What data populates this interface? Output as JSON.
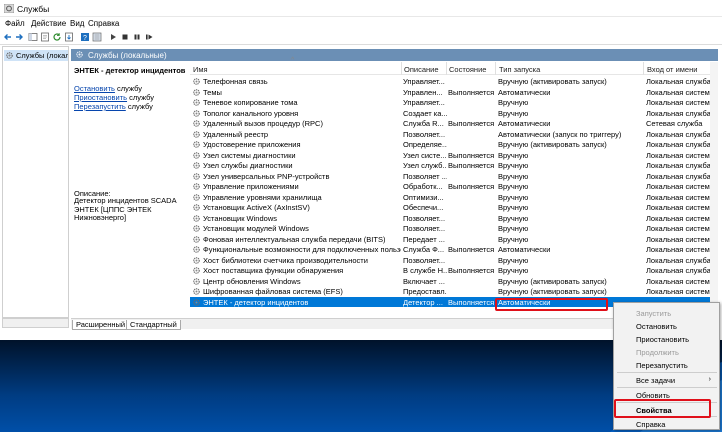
{
  "window": {
    "title": "Службы"
  },
  "menu": [
    "Файл",
    "Действие",
    "Вид",
    "Справка"
  ],
  "tree": {
    "item": "Службы (локальные)"
  },
  "header": {
    "title": "Службы (локальные)"
  },
  "description_panel": {
    "service_name": "ЭНТЕК - детектор инцидентов",
    "actions": [
      {
        "link": "Остановить",
        "suffix": " службу"
      },
      {
        "link": "Приостановить",
        "suffix": " службу"
      },
      {
        "link": "Перезапустить",
        "suffix": " службу"
      }
    ],
    "description_label": "Описание:",
    "description_text": "Детектор инцидентов SCADA ЭНТЕК [ЦППС ЭНТЕК Нижновэнерго]"
  },
  "columns": {
    "name": "Имя",
    "description": "Описание",
    "state": "Состояние",
    "startup_type": "Тип запуска",
    "logon": "Вход от имени"
  },
  "rows": [
    {
      "name": "Телефонная связь",
      "desc": "Управляет...",
      "state": "",
      "type": "Вручную (активировать запуск)",
      "logon": "Локальная служба"
    },
    {
      "name": "Темы",
      "desc": "Управлен...",
      "state": "Выполняется",
      "type": "Автоматически",
      "logon": "Локальная система"
    },
    {
      "name": "Теневое копирование тома",
      "desc": "Управляет...",
      "state": "",
      "type": "Вручную",
      "logon": "Локальная система"
    },
    {
      "name": "Тополог канального уровня",
      "desc": "Создает ка...",
      "state": "",
      "type": "Вручную",
      "logon": "Локальная служба"
    },
    {
      "name": "Удаленный вызов процедур (RPC)",
      "desc": "Служба R...",
      "state": "Выполняется",
      "type": "Автоматически",
      "logon": "Сетевая служба"
    },
    {
      "name": "Удаленный реестр",
      "desc": "Позволяет...",
      "state": "",
      "type": "Автоматически (запуск по триггеру)",
      "logon": "Локальная служба"
    },
    {
      "name": "Удостоверение приложения",
      "desc": "Определяе...",
      "state": "",
      "type": "Вручную (активировать запуск)",
      "logon": "Локальная служба"
    },
    {
      "name": "Узел системы диагностики",
      "desc": "Узел систе...",
      "state": "Выполняется",
      "type": "Вручную",
      "logon": "Локальная система"
    },
    {
      "name": "Узел службы диагностики",
      "desc": "Узел служб...",
      "state": "Выполняется",
      "type": "Вручную",
      "logon": "Локальная служба"
    },
    {
      "name": "Узел универсальных PNP-устройств",
      "desc": "Позволяет ...",
      "state": "",
      "type": "Вручную",
      "logon": "Локальная служба"
    },
    {
      "name": "Управление приложениями",
      "desc": "Обработк...",
      "state": "Выполняется",
      "type": "Вручную",
      "logon": "Локальная система"
    },
    {
      "name": "Управление уровнями хранилища",
      "desc": "Оптимизи...",
      "state": "",
      "type": "Вручную",
      "logon": "Локальная система"
    },
    {
      "name": "Установщик ActiveX (AxInstSV)",
      "desc": "Обеспечи...",
      "state": "",
      "type": "Вручную",
      "logon": "Локальная система"
    },
    {
      "name": "Установщик Windows",
      "desc": "Позволяет...",
      "state": "",
      "type": "Вручную",
      "logon": "Локальная система"
    },
    {
      "name": "Установщик модулей Windows",
      "desc": "Позволяет...",
      "state": "",
      "type": "Вручную",
      "logon": "Локальная система"
    },
    {
      "name": "Фоновая интеллектуальная служба передачи (BITS)",
      "desc": "Передает ...",
      "state": "",
      "type": "Вручную",
      "logon": "Локальная система"
    },
    {
      "name": "Функциональные возможности для подключенных пользова...",
      "desc": "Служба Ф...",
      "state": "Выполняется",
      "type": "Автоматически",
      "logon": "Локальная система"
    },
    {
      "name": "Хост библиотеки счетчика производительности",
      "desc": "Позволяет...",
      "state": "",
      "type": "Вручную",
      "logon": "Локальная служба"
    },
    {
      "name": "Хост поставщика функции обнаружения",
      "desc": "В службе Н...",
      "state": "Выполняется",
      "type": "Вручную",
      "logon": "Локальная служба"
    },
    {
      "name": "Центр обновления Windows",
      "desc": "Включает ...",
      "state": "",
      "type": "Вручную (активировать запуск)",
      "logon": "Локальная система"
    },
    {
      "name": "Шифрованная файловая система (EFS)",
      "desc": "Предоставл...",
      "state": "",
      "type": "Вручную (активировать запуск)",
      "logon": "Локальная система"
    },
    {
      "name": "ЭНТЕК - детектор инцидентов",
      "desc": "Детектор ...",
      "state": "Выполняется",
      "type": "Автоматически",
      "logon": ""
    }
  ],
  "tabs": [
    "Расширенный",
    "Стандартный"
  ],
  "context_menu": {
    "items": [
      "Запустить",
      "Остановить",
      "Приостановить",
      "Продолжить",
      "Перезапустить",
      "Все задачи",
      "Обновить",
      "Свойства",
      "Справка"
    ]
  },
  "colors": {
    "selection": "#0078d7",
    "header": "#6b8fb5",
    "highlight_box": "#e0101a"
  }
}
